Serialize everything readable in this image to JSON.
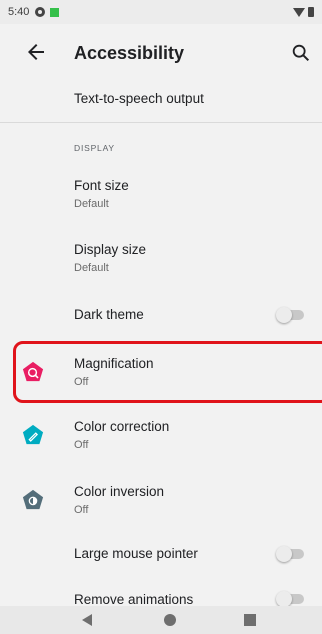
{
  "status_bar": {
    "time": "5:40"
  },
  "app_bar": {
    "title": "Accessibility"
  },
  "list": {
    "tts": {
      "title": "Text-to-speech output"
    },
    "display_header": "DISPLAY",
    "font_size": {
      "title": "Font size",
      "summary": "Default"
    },
    "display_size": {
      "title": "Display size",
      "summary": "Default"
    },
    "dark_theme": {
      "title": "Dark theme",
      "state": "off"
    },
    "magnification": {
      "title": "Magnification",
      "summary": "Off",
      "icon": "magnification-icon",
      "color": "#e91e63"
    },
    "color_correction": {
      "title": "Color correction",
      "summary": "Off",
      "icon": "color-correction-icon",
      "color": "#00acc1"
    },
    "color_inversion": {
      "title": "Color inversion",
      "summary": "Off",
      "icon": "color-inversion-icon",
      "color": "#546e7a"
    },
    "large_mouse_pointer": {
      "title": "Large mouse pointer",
      "state": "off"
    },
    "remove_animations": {
      "title": "Remove animations",
      "state": "off"
    }
  },
  "colors": {
    "highlight": "#e0141b",
    "background": "#f2f2f2"
  }
}
